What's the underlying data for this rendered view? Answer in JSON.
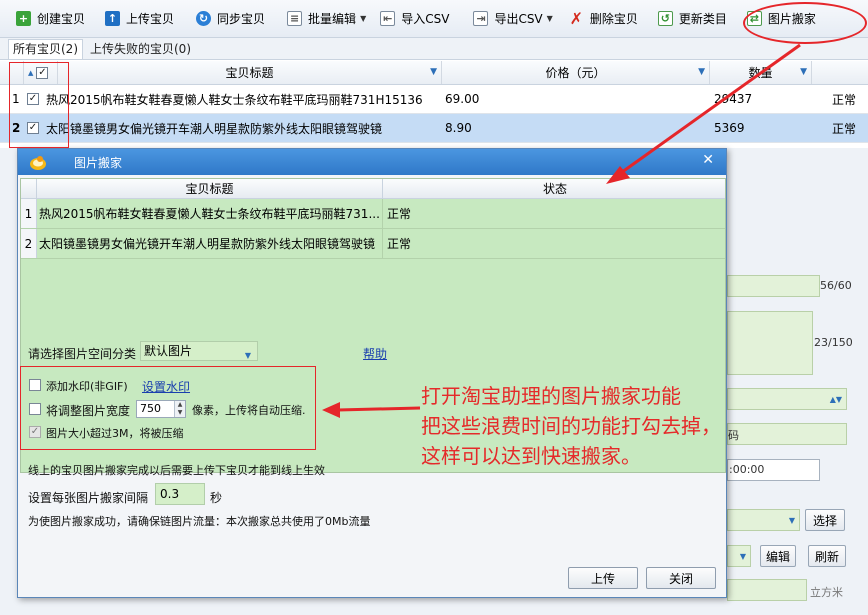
{
  "toolbar": {
    "buttons": [
      {
        "label": "创建宝贝",
        "icon": "plus-icon"
      },
      {
        "label": "上传宝贝",
        "icon": "upload-icon"
      },
      {
        "label": "同步宝贝",
        "icon": "sync-icon"
      },
      {
        "label": "批量编辑",
        "icon": "batch-edit-icon"
      },
      {
        "label": "导入CSV",
        "icon": "import-csv-icon"
      },
      {
        "label": "导出CSV",
        "icon": "export-csv-icon"
      },
      {
        "label": "删除宝贝",
        "icon": "delete-icon"
      },
      {
        "label": "更新类目",
        "icon": "update-category-icon"
      },
      {
        "label": "图片搬家",
        "icon": "image-move-icon"
      }
    ]
  },
  "tabs": [
    {
      "label": "所有宝贝(2)"
    },
    {
      "label": "上传失败的宝贝(0)"
    }
  ],
  "main_table": {
    "headers": {
      "title": "宝贝标题",
      "price": "价格（元）",
      "quantity": "数量"
    },
    "rows": [
      {
        "num": "1",
        "title": "热风2015帆布鞋女鞋春夏懒人鞋女士条纹布鞋平底玛丽鞋731H15136",
        "price": "69.00",
        "quantity": "29437",
        "status": "正常"
      },
      {
        "num": "2",
        "title": "太阳镜墨镜男女偏光镜开车潮人明星款防紫外线太阳眼镜驾驶镜",
        "price": "8.90",
        "quantity": "5369",
        "status": "正常"
      }
    ]
  },
  "background": {
    "counter1": "56/60",
    "counter2": "23/150",
    "time_value": ":00:00",
    "partial_char": "码",
    "select_button": "选择",
    "edit_button": "编辑",
    "refresh_button": "刷新",
    "unit_label": "立方米"
  },
  "dialog": {
    "title": "图片搬家",
    "columns": {
      "title": "宝贝标题",
      "status": "状态"
    },
    "rows": [
      {
        "num": "1",
        "title": "热风2015帆布鞋女鞋春夏懒人鞋女士条纹布鞋平底玛丽鞋731...",
        "status": "正常"
      },
      {
        "num": "2",
        "title": "太阳镜墨镜男女偏光镜开车潮人明星款防紫外线太阳眼镜驾驶镜",
        "status": "正常"
      }
    ],
    "category_label": "请选择图片空间分类",
    "category_value": "默认图片",
    "help_link": "帮助",
    "watermark_label": "添加水印(非GIF)",
    "watermark_link": "设置水印",
    "resize_label": "将调整图片宽度",
    "resize_value": "750",
    "resize_suffix": "像素，上传将自动压缩.",
    "compress_label": "图片大小超过3M，将被压缩",
    "note_online": "线上的宝贝图片搬家完成以后需要上传下宝贝才能到线上生效",
    "interval_label": "设置每张图片搬家间隔",
    "interval_value": "0.3",
    "interval_unit": "秒",
    "traffic_note": "为使图片搬家成功，请确保链图片流量：本次搬家总共使用了0Mb流量",
    "upload_button": "上传",
    "close_button": "关闭"
  },
  "annotation": {
    "lines": [
      "打开淘宝助理的图片搬家功能",
      "把这些浪费时间的功能打勾去掉，",
      "这样可以达到快速搬家。"
    ],
    "color": "#e52a2a"
  }
}
